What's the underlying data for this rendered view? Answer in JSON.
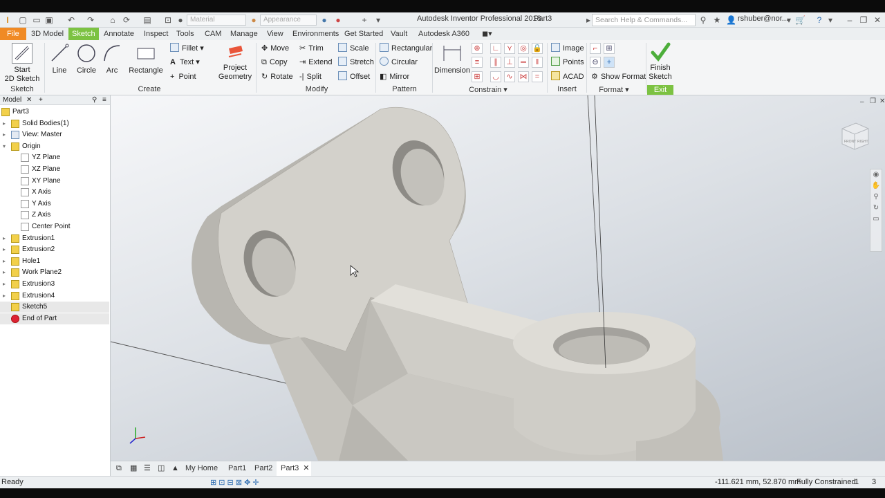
{
  "titlebar": {
    "title": "Autodesk Inventor Professional 2018",
    "doc": "Part3",
    "search_placeholder": "Search Help & Commands...",
    "user": "rshuber@nor...",
    "material_combo": "Material",
    "appearance_combo": "Appearance"
  },
  "menu": [
    "File",
    "3D Model",
    "Sketch",
    "Annotate",
    "Inspect",
    "Tools",
    "CAM",
    "Manage",
    "View",
    "Environments",
    "Get Started",
    "Vault",
    "Autodesk A360"
  ],
  "ribbon": {
    "start_sketch_1": "Start",
    "start_sketch_2": "2D Sketch",
    "line": "Line",
    "circle": "Circle",
    "arc": "Arc",
    "rectangle": "Rectangle",
    "fillet": "Fillet",
    "text": "Text",
    "point": "Point",
    "project_1": "Project",
    "project_2": "Geometry",
    "move": "Move",
    "copy": "Copy",
    "rotate": "Rotate",
    "trim": "Trim",
    "extend": "Extend",
    "split": "Split",
    "scale": "Scale",
    "stretch": "Stretch",
    "offset": "Offset",
    "rect_pattern": "Rectangular",
    "circ_pattern": "Circular",
    "mirror": "Mirror",
    "dimension": "Dimension",
    "image": "Image",
    "points": "Points",
    "acad": "ACAD",
    "show_format": "Show Format",
    "finish_1": "Finish",
    "finish_2": "Sketch",
    "groups": {
      "sketch": "Sketch",
      "create": "Create",
      "modify": "Modify",
      "pattern": "Pattern",
      "constrain": "Constrain",
      "insert": "Insert",
      "format": "Format",
      "exit": "Exit"
    }
  },
  "browser": {
    "tab": "Model",
    "items": [
      {
        "label": "Part3",
        "indent": 0
      },
      {
        "label": "Solid Bodies(1)",
        "indent": 1
      },
      {
        "label": "View: Master",
        "indent": 1
      },
      {
        "label": "Origin",
        "indent": 1
      },
      {
        "label": "YZ Plane",
        "indent": 2
      },
      {
        "label": "XZ Plane",
        "indent": 2
      },
      {
        "label": "XY Plane",
        "indent": 2
      },
      {
        "label": "X Axis",
        "indent": 2
      },
      {
        "label": "Y Axis",
        "indent": 2
      },
      {
        "label": "Z Axis",
        "indent": 2
      },
      {
        "label": "Center Point",
        "indent": 2
      },
      {
        "label": "Extrusion1",
        "indent": 1
      },
      {
        "label": "Extrusion2",
        "indent": 1
      },
      {
        "label": "Hole1",
        "indent": 1
      },
      {
        "label": "Work Plane2",
        "indent": 1
      },
      {
        "label": "Extrusion3",
        "indent": 1
      },
      {
        "label": "Extrusion4",
        "indent": 1
      },
      {
        "label": "Sketch5",
        "indent": 1
      },
      {
        "label": "End of Part",
        "indent": 1
      }
    ]
  },
  "doctabs": [
    "My Home",
    "Part1",
    "Part2",
    "Part3"
  ],
  "viewcube": {
    "front": "FRONT",
    "right": "RIGHT"
  },
  "status": {
    "left": "Ready",
    "coords": "-111.621 mm, 52.870 mm",
    "constraint": "Fully Constrained",
    "n1": "1",
    "n2": "3"
  },
  "colors": {
    "accent": "#7cc242",
    "file": "#f08a24"
  }
}
